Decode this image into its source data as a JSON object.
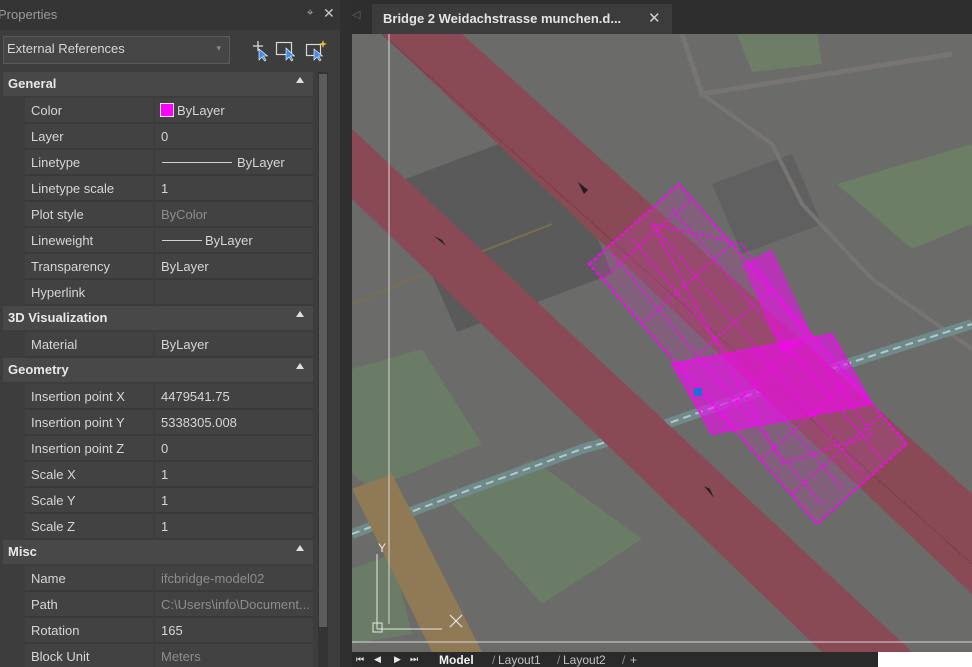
{
  "panel": {
    "title": "Properties",
    "selection_type": "External References",
    "tools": [
      "quick-select-icon",
      "select-objects-icon",
      "toggle-pickadd-icon"
    ]
  },
  "sections": {
    "general": {
      "label": "General",
      "color": {
        "key": "Color",
        "value": "ByLayer",
        "swatch": "#ff00ff"
      },
      "layer": {
        "key": "Layer",
        "value": "0"
      },
      "linetype": {
        "key": "Linetype",
        "value": "ByLayer"
      },
      "linetype_scale": {
        "key": "Linetype scale",
        "value": "1"
      },
      "plot_style": {
        "key": "Plot style",
        "value": "ByColor"
      },
      "lineweight": {
        "key": "Lineweight",
        "value": "ByLayer"
      },
      "transparency": {
        "key": "Transparency",
        "value": "ByLayer"
      },
      "hyperlink": {
        "key": "Hyperlink",
        "value": ""
      }
    },
    "visualization": {
      "label": "3D Visualization",
      "material": {
        "key": "Material",
        "value": "ByLayer"
      }
    },
    "geometry": {
      "label": "Geometry",
      "insertion_x": {
        "key": "Insertion point X",
        "value": "4479541.75"
      },
      "insertion_y": {
        "key": "Insertion point Y",
        "value": "5338305.008"
      },
      "insertion_z": {
        "key": "Insertion point Z",
        "value": "0"
      },
      "scale_x": {
        "key": "Scale X",
        "value": "1"
      },
      "scale_y": {
        "key": "Scale Y",
        "value": "1"
      },
      "scale_z": {
        "key": "Scale Z",
        "value": "1"
      }
    },
    "misc": {
      "label": "Misc",
      "name": {
        "key": "Name",
        "value": "ifcbridge-model02"
      },
      "path": {
        "key": "Path",
        "value": "C:\\Users\\info\\Document..."
      },
      "rotation": {
        "key": "Rotation",
        "value": "165"
      },
      "block_unit": {
        "key": "Block Unit",
        "value": "Meters"
      }
    }
  },
  "document": {
    "tab_title": "Bridge 2 Weidachstrasse munchen.d...",
    "close_glyph": "✕"
  },
  "viewport": {
    "ucs_y_label": "Y",
    "model_color": "#ff00ff",
    "grip_color": "#1e6fd9"
  },
  "layout_tabs": {
    "model": "Model",
    "layout1": "Layout1",
    "layout2": "Layout2",
    "add": "+"
  },
  "colors": {
    "panel_bg": "#3d3d3d",
    "road": "#8a4a55",
    "map_bg": "#6a6a69"
  }
}
